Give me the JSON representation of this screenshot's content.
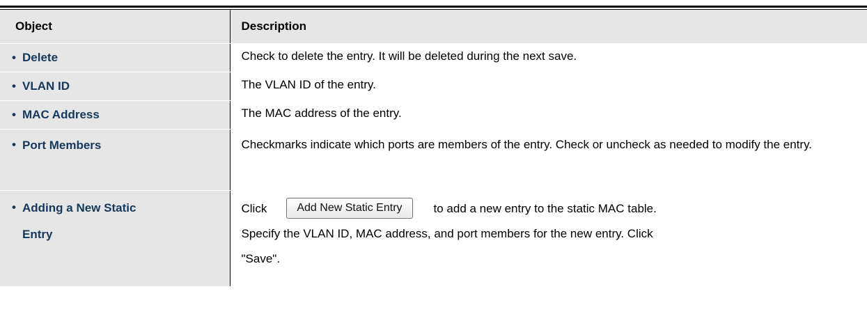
{
  "table": {
    "headers": {
      "object": "Object",
      "description": "Description"
    },
    "rows": [
      {
        "object": "Delete",
        "description": "Check to delete the entry. It will be deleted during the next save."
      },
      {
        "object": "VLAN ID",
        "description": "The VLAN ID of the entry."
      },
      {
        "object": "MAC Address",
        "description": "The MAC address of the entry."
      },
      {
        "object": "Port Members",
        "description": "Checkmarks indicate which ports are members of the entry. Check or uncheck as needed to modify the entry."
      },
      {
        "object_line1": "Adding a New Static",
        "object_line2": "Entry",
        "description_prefix": "Click",
        "button_label": "Add New Static Entry",
        "description_suffix": "to add a new entry to the static MAC table.",
        "description_line2": "Specify the VLAN ID, MAC address, and port members for the new entry. Click",
        "description_line3": "\"Save\"."
      }
    ]
  },
  "colors": {
    "header_bg": "#e6e6e6",
    "object_text": "#17385a",
    "bullet": "•"
  }
}
